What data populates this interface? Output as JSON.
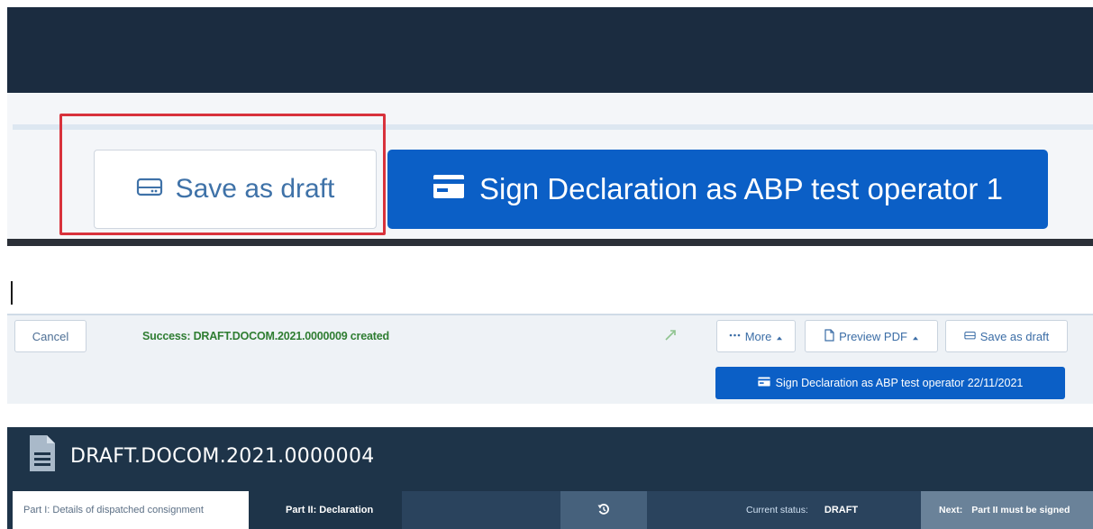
{
  "zoomed_bar": {
    "save_draft_label": "Save as draft",
    "sign_label": "Sign Declaration as ABP test operator 1"
  },
  "action_bar": {
    "cancel_label": "Cancel",
    "success_message": "Success: DRAFT.DOCOM.2021.0000009 created",
    "more_label": "More",
    "preview_pdf_label": "Preview PDF",
    "save_draft_label": "Save as draft",
    "sign_label": "Sign Declaration as ABP test operator 22/11/2021"
  },
  "document": {
    "title": "DRAFT.DOCOM.2021.0000004",
    "tabs": [
      {
        "label": "Part I: Details of dispatched consignment",
        "active": true
      },
      {
        "label": "Part II: Declaration",
        "active": false
      }
    ],
    "status_label": "Current status:",
    "status_value": "DRAFT",
    "next_label": "Next:",
    "next_value": "Part II must be signed"
  },
  "colors": {
    "navy": "#1b2c40",
    "primary_blue": "#0b5fc6",
    "link_blue": "#3f72a8",
    "success_green": "#2f7d32",
    "highlight_red": "#d8323c"
  },
  "icons": {
    "save_draft": "drive-icon",
    "sign": "id-card-icon",
    "more": "ellipsis-icon",
    "preview_pdf": "file-icon",
    "caret": "caret-up-icon",
    "resize": "expand-icon",
    "document": "document-icon",
    "undo": "history-icon"
  }
}
